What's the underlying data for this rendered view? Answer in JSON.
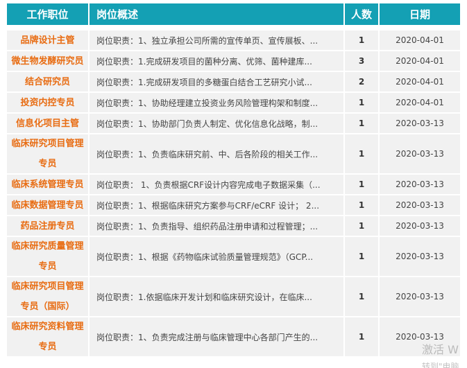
{
  "header": {
    "col_title": "工作职位",
    "col_desc": "岗位概述",
    "col_count": "人数",
    "col_date": "日期"
  },
  "rows": [
    {
      "title": "品牌设计主管",
      "desc": "岗位职责：1、独立承担公司所需的宣传单页、宣传展板、...",
      "count": "1",
      "date": "2020-04-01"
    },
    {
      "title": "微生物发酵研究员",
      "desc": "岗位职责：1.完成研发项目的菌种分离、优筛、菌种建库...",
      "count": "3",
      "date": "2020-04-01"
    },
    {
      "title": "结合研究员",
      "desc": "岗位职责：1.完成研发项目的多糖蛋白结合工艺研究小试...",
      "count": "2",
      "date": "2020-04-01"
    },
    {
      "title": "投资内控专员",
      "desc": "岗位职责：1、协助经理建立投资业务风险管理构架和制度...",
      "count": "1",
      "date": "2020-04-01"
    },
    {
      "title": "信息化项目主管",
      "desc": "岗位职责：1、协助部门负责人制定、优化信息化战略，制...",
      "count": "1",
      "date": "2020-03-13"
    },
    {
      "title": "临床研究项目管理专员",
      "desc": "岗位职责：1、负责临床研究前、中、后各阶段的相关工作...",
      "count": "1",
      "date": "2020-03-13"
    },
    {
      "title": "临床系统管理专员",
      "desc": "岗位职责： 1、负责根据CRF设计内容完成电子数据采集（...",
      "count": "1",
      "date": "2020-03-13"
    },
    {
      "title": "临床数据管理专员",
      "desc": "岗位职责：1、根据临床研究方案参与CRF/eCRF 设计； 2...",
      "count": "1",
      "date": "2020-03-13"
    },
    {
      "title": "药品注册专员",
      "desc": "岗位职责：1、负责指导、组织药品注册申请和过程管理；...",
      "count": "1",
      "date": "2020-03-13"
    },
    {
      "title": "临床研究质量管理专员",
      "desc": "岗位职责：1、根据《药物临床试验质量管理规范》（GCP...",
      "count": "1",
      "date": "2020-03-13"
    },
    {
      "title": "临床研究项目管理专员（国际）",
      "desc": "岗位职责：1.依据临床开发计划和临床研究设计，在临床...",
      "count": "1",
      "date": "2020-03-13"
    },
    {
      "title": "临床研究资料管理专员",
      "desc": "岗位职责：1、负责完成注册与临床管理中心各部门产生的...",
      "count": "1",
      "date": "2020-03-13"
    }
  ],
  "watermark": {
    "line1": "激活 W",
    "line2": "转到\"电脑"
  }
}
